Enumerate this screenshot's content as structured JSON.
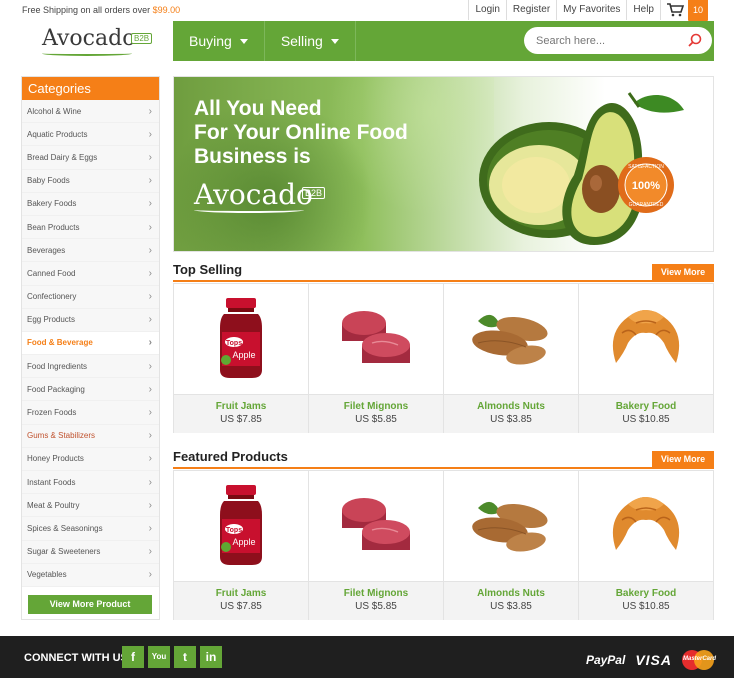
{
  "topbar": {
    "shipping_text": "Free Shipping on all orders over",
    "shipping_amount": "$99.00",
    "links": {
      "login": "Login",
      "register": "Register",
      "favorites": "My Favorites",
      "help": "Help"
    },
    "cart_count": "10",
    "cart_icon": "cart-icon"
  },
  "brand": {
    "logo": "Avocado",
    "badge": "B2B"
  },
  "nav": {
    "buying": "Buying",
    "selling": "Selling"
  },
  "search": {
    "placeholder": "Search here...",
    "icon": "search-icon"
  },
  "sidebar": {
    "title": "Categories",
    "items": [
      "Alcohol & Wine",
      "Aquatic Products",
      "Bread Dairy & Eggs",
      "Baby Foods",
      "Bakery Foods",
      "Bean Products",
      "Beverages",
      "Canned Food",
      "Confectionery",
      "Egg Products",
      "Food & Beverage",
      "Food Ingredients",
      "Food Packaging",
      "Frozen Foods",
      "Gums & Stabilizers",
      "Honey Products",
      "Instant Foods",
      "Meat & Poultry",
      "Spices & Seasonings",
      "Sugar & Sweeteners",
      "Vegetables"
    ],
    "active_item": "Food & Beverage",
    "view_more": "View More Product"
  },
  "banner": {
    "line1": "All You Need",
    "line2": "For Your Online Food",
    "line3": "Business is",
    "logo": "Avocado",
    "badge": "B2B",
    "seal": "100%",
    "seal_top": "SATISFACTION",
    "seal_bottom": "GUARANTEED"
  },
  "top_selling": {
    "title": "Top Selling",
    "view_more": "View More",
    "products": [
      {
        "name": "Fruit Jams",
        "price": "US $7.85",
        "jar_label": "Apple"
      },
      {
        "name": "Filet Mignons",
        "price": "US $5.85"
      },
      {
        "name": "Almonds Nuts",
        "price": "US $3.85"
      },
      {
        "name": "Bakery Food",
        "price": "US $10.85"
      }
    ]
  },
  "featured": {
    "title": "Featured Products",
    "view_more": "View More",
    "products": [
      {
        "name": "Fruit Jams",
        "price": "US $7.85",
        "jar_label": "Apple"
      },
      {
        "name": "Filet Mignons",
        "price": "US $5.85"
      },
      {
        "name": "Almonds Nuts",
        "price": "US $3.85"
      },
      {
        "name": "Bakery Food",
        "price": "US $10.85"
      }
    ]
  },
  "footer": {
    "connect": "CONNECT WITH US",
    "social": {
      "facebook": "f",
      "youtube": "You",
      "twitter": "t",
      "linkedin": "in"
    },
    "payments": {
      "paypal": "PayPal",
      "visa": "VISA",
      "mastercard": "MasterCard"
    }
  },
  "colors": {
    "green": "#64a637",
    "orange": "#f57f17",
    "dark": "#1f1f1f"
  }
}
